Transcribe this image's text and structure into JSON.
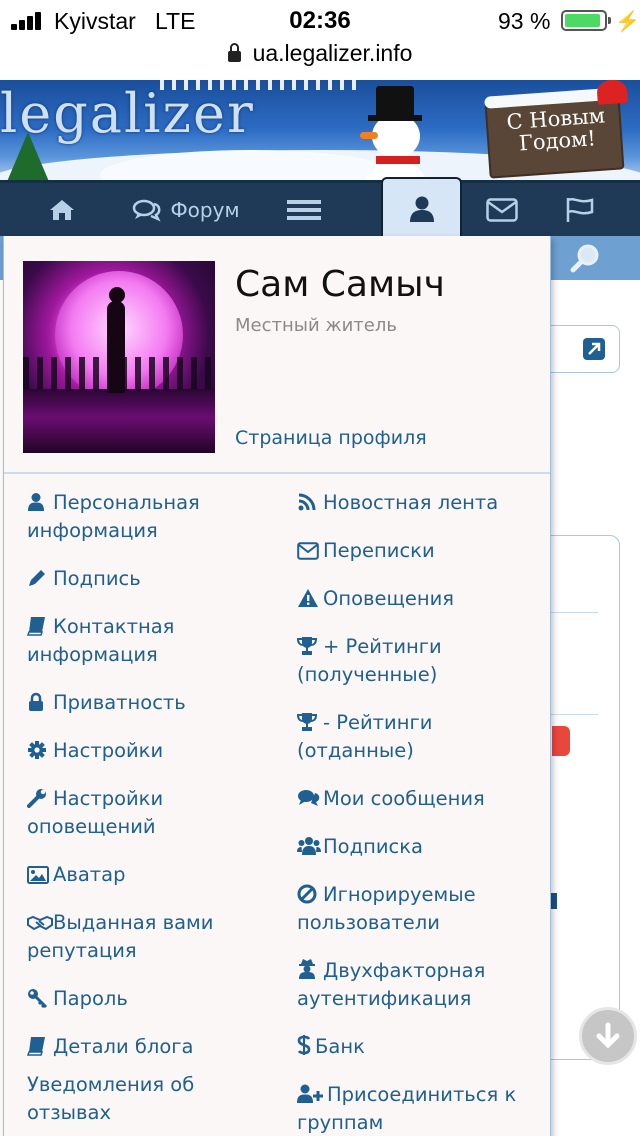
{
  "status_bar": {
    "carrier": "Kyivstar",
    "network": "LTE",
    "time": "02:36",
    "battery_percent": "93 %",
    "battery_level": 0.93,
    "url": "ua.legalizer.info"
  },
  "banner": {
    "logo": "legalizer",
    "sign_text": "С Новым Годом!"
  },
  "nav": {
    "forum_label": "Форум",
    "items": [
      "home-icon",
      "forum-icon",
      "menu-icon",
      "user-icon",
      "envelope-icon",
      "flag-icon"
    ]
  },
  "profile": {
    "name": "Сам Самыч",
    "title": "Местный житель",
    "profile_link": "Страница профиля"
  },
  "menu_left": [
    {
      "label": "Персональная информация",
      "icon": "user-icon"
    },
    {
      "label": "Подпись",
      "icon": "pencil-icon"
    },
    {
      "label": "Контактная информация",
      "icon": "book-icon"
    },
    {
      "label": "Приватность",
      "icon": "lock-icon"
    },
    {
      "label": "Настройки",
      "icon": "gear-icon"
    },
    {
      "label": "Настройки оповещений",
      "icon": "wrench-icon"
    },
    {
      "label": "Аватар",
      "icon": "image-icon"
    },
    {
      "label": "Выданная вами репутация",
      "icon": "handshake-icon"
    },
    {
      "label": "Пароль",
      "icon": "key-icon"
    },
    {
      "label": "Детали блога",
      "icon": "book-icon"
    },
    {
      "label": "Уведомления об отзывах",
      "icon": ""
    }
  ],
  "menu_right": [
    {
      "label": "Новостная лента",
      "icon": "rss-icon"
    },
    {
      "label": "Переписки",
      "icon": "envelope-icon"
    },
    {
      "label": "Оповещения",
      "icon": "warning-icon"
    },
    {
      "label": "+ Рейтинги (полученные)",
      "icon": "trophy-icon"
    },
    {
      "label": "- Рейтинги (отданные)",
      "icon": "trophy-icon"
    },
    {
      "label": "Мои сообщения",
      "icon": "comments-icon"
    },
    {
      "label": "Подписка",
      "icon": "users-icon"
    },
    {
      "label": "Игнорируемые пользователи",
      "icon": "ban-icon"
    },
    {
      "label": "Двухфакторная аутентификация",
      "icon": "user-secret-icon"
    },
    {
      "label": "Банк",
      "icon": "dollar-icon"
    },
    {
      "label": "Присоединиться к группам",
      "icon": "user-plus-icon"
    }
  ],
  "colors": {
    "link": "#1f5f91",
    "navbar": "#1e3a56",
    "dropdown_bg": "#fbf7f6"
  }
}
